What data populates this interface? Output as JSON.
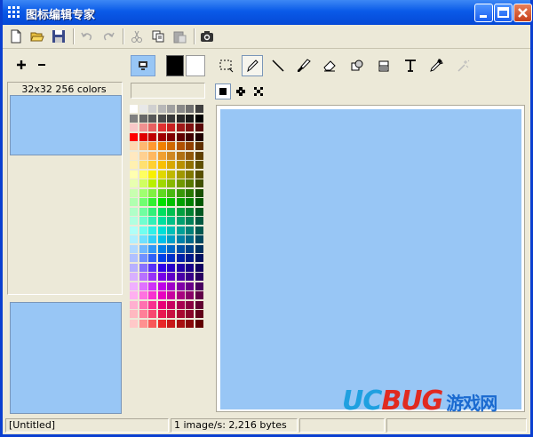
{
  "window": {
    "title": "图标编辑专家"
  },
  "left_panel": {
    "format_caption": "32x32 256 colors"
  },
  "status": {
    "file": "[Untitled]",
    "info": "1 image/s: 2,216 bytes"
  },
  "watermark": {
    "uc": "UC",
    "bug": "BUG",
    "cn": "游戏网"
  },
  "colors": {
    "canvas_bg": "#98c6f5",
    "foreground": "#000000",
    "background": "#ffffff"
  },
  "palette": [
    [
      "#ffffff",
      "#e8e8e8",
      "#d0d0d0",
      "#b8b8b8",
      "#a0a0a0",
      "#888888",
      "#707070",
      "#404040"
    ],
    [
      "#808080",
      "#686868",
      "#585858",
      "#484848",
      "#383838",
      "#282828",
      "#181818",
      "#000000"
    ],
    [
      "#f8c8c8",
      "#f09090",
      "#e86060",
      "#e03030",
      "#c82020",
      "#a01818",
      "#801010",
      "#580808"
    ],
    [
      "#ff0000",
      "#e00000",
      "#c00000",
      "#a00000",
      "#800000",
      "#600000",
      "#400000",
      "#200000"
    ],
    [
      "#ffd8b0",
      "#ffb870",
      "#ff9830",
      "#f08000",
      "#d06800",
      "#b05000",
      "#904000",
      "#603000"
    ],
    [
      "#ffe8c0",
      "#ffd090",
      "#ffb860",
      "#f0a030",
      "#d08820",
      "#b07010",
      "#905808",
      "#604000"
    ],
    [
      "#fff0b0",
      "#ffe070",
      "#ffd030",
      "#f8c000",
      "#d8a800",
      "#b89000",
      "#907000",
      "#605000"
    ],
    [
      "#ffffb0",
      "#ffff60",
      "#f8f000",
      "#e0d800",
      "#c0b800",
      "#a09800",
      "#807800",
      "#585000"
    ],
    [
      "#e8ffb0",
      "#d0ff60",
      "#b8f000",
      "#a0d800",
      "#88b800",
      "#709800",
      "#587800",
      "#405000"
    ],
    [
      "#c8ffb0",
      "#a0ff70",
      "#80f040",
      "#60d820",
      "#48b810",
      "#389808",
      "#287800",
      "#185000"
    ],
    [
      "#b0ffb0",
      "#70ff70",
      "#30f030",
      "#00e000",
      "#00c000",
      "#00a000",
      "#008000",
      "#005800"
    ],
    [
      "#b0ffc8",
      "#70ffa0",
      "#30f078",
      "#00e060",
      "#00c050",
      "#00a040",
      "#008030",
      "#005820"
    ],
    [
      "#b0ffe0",
      "#70ffd0",
      "#30f0b8",
      "#00e0a0",
      "#00c088",
      "#00a070",
      "#008058",
      "#005840"
    ],
    [
      "#b0fff8",
      "#70fff0",
      "#30f0e8",
      "#00e0d8",
      "#00c0b8",
      "#00a098",
      "#008078",
      "#005850"
    ],
    [
      "#b0f0ff",
      "#70e0ff",
      "#30d0f8",
      "#00c0e8",
      "#00a0c8",
      "#0080a8",
      "#006888",
      "#004860"
    ],
    [
      "#b0d8ff",
      "#70b8ff",
      "#3098f8",
      "#0080e8",
      "#0068c8",
      "#0050a8",
      "#004088",
      "#003060"
    ],
    [
      "#b0c0ff",
      "#7090ff",
      "#3060f8",
      "#0040e8",
      "#0030c8",
      "#0020a8",
      "#001888",
      "#001060"
    ],
    [
      "#b8b0ff",
      "#8870ff",
      "#5830f8",
      "#3000e8",
      "#2800c8",
      "#2000a8",
      "#180088",
      "#100060"
    ],
    [
      "#d8b0ff",
      "#b870ff",
      "#9830f8",
      "#7800e8",
      "#6000c8",
      "#4800a8",
      "#380088",
      "#280060"
    ],
    [
      "#f0b0ff",
      "#e070ff",
      "#d030f8",
      "#c000e8",
      "#a000c8",
      "#8000a8",
      "#680088",
      "#480060"
    ],
    [
      "#ffb0f0",
      "#ff70e0",
      "#f830d0",
      "#e800c0",
      "#c800a0",
      "#a80080",
      "#880068",
      "#600048"
    ],
    [
      "#ffb0d0",
      "#ff70b0",
      "#f83090",
      "#e80078",
      "#c80060",
      "#a80050",
      "#880040",
      "#600030"
    ],
    [
      "#ffb8c0",
      "#ff8098",
      "#f84870",
      "#e81850",
      "#c81040",
      "#a80830",
      "#880428",
      "#600018"
    ],
    [
      "#ffc8c8",
      "#ff9090",
      "#f85858",
      "#e82828",
      "#c81818",
      "#a81010",
      "#880808",
      "#600000"
    ]
  ]
}
